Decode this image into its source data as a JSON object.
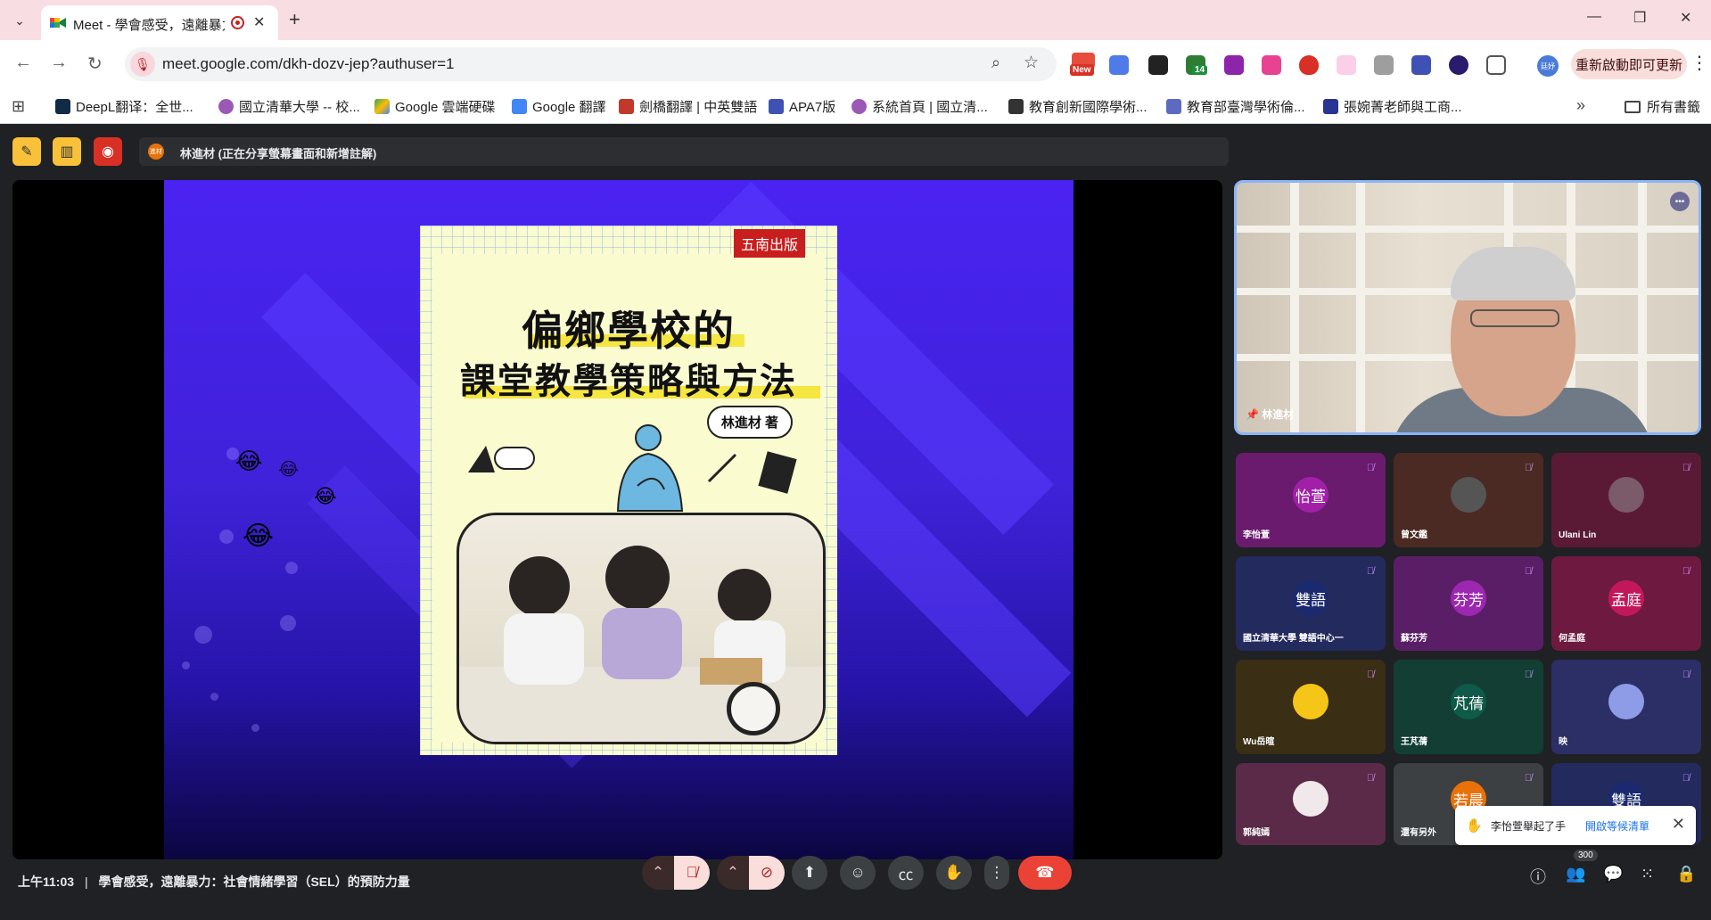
{
  "browser": {
    "tab_title": "Meet - 學會感受，遠離暴力",
    "url": "meet.google.com/dkh-dozv-jep?authuser=1",
    "new_badge": "New",
    "ext_badge": "14",
    "profile_initials": "廷妤",
    "restart_label": "重新啟動即可更新",
    "bookmarks": [
      {
        "label": "DeepL翻译：全世...",
        "color": "#0f2b46"
      },
      {
        "label": "國立清華大學 -- 校...",
        "color": "#9b59b6"
      },
      {
        "label": "Google 雲端硬碟",
        "color": "#34a853"
      },
      {
        "label": "Google 翻譯",
        "color": "#4285f4"
      },
      {
        "label": "劍橋翻譯 | 中英雙語",
        "color": "#c0392b"
      },
      {
        "label": "APA7版",
        "color": "#3f51b5"
      },
      {
        "label": "系統首頁 | 國立清...",
        "color": "#9b59b6"
      },
      {
        "label": "教育創新國際學術...",
        "color": "#333333"
      },
      {
        "label": "教育部臺灣學術倫...",
        "color": "#5c6bc0"
      },
      {
        "label": "張婉菁老師與工商...",
        "color": "#283593"
      }
    ],
    "all_bookmarks": "所有書籤"
  },
  "meet": {
    "presenter_avatar": "進材",
    "presenter_text": "林進材 (正在分享螢幕畫面和新增註解)",
    "slide": {
      "publisher": "五南出版",
      "title_line1": "偏鄉學校的",
      "title_line2": "課堂教學策略與方法",
      "author": "林進材 著"
    },
    "main_video": {
      "name": "林進材"
    },
    "tiles": [
      {
        "name": "李怡萱",
        "avatar": "怡萱",
        "bg": "#6a1b6e",
        "av": "#a020a8"
      },
      {
        "name": "曾文鑑",
        "avatar": "",
        "bg": "#4a2a22",
        "av": "#555555"
      },
      {
        "name": "Ulani Lin",
        "avatar": "",
        "bg": "#5a1a36",
        "av": "#7b5a6a"
      },
      {
        "name": "國立清華大學 雙語中心一",
        "avatar": "雙語",
        "bg": "#232a5e",
        "av": "#1b2a6e"
      },
      {
        "name": "蘇芬芳",
        "avatar": "芬芳",
        "bg": "#5a1e66",
        "av": "#9c27b0"
      },
      {
        "name": "何孟庭",
        "avatar": "孟庭",
        "bg": "#6e1a40",
        "av": "#c2185b"
      },
      {
        "name": "Wu岳暄",
        "avatar": "",
        "bg": "#3a2e14",
        "av": "#f5c518"
      },
      {
        "name": "王芃蒨",
        "avatar": "芃蒨",
        "bg": "#123e34",
        "av": "#0f5a48"
      },
      {
        "name": "映",
        "avatar": "",
        "bg": "#2c2e66",
        "av": "#8e9ce8"
      },
      {
        "name": "郭純嫣",
        "avatar": "",
        "bg": "#5a2a48",
        "av": "#f0e8ea"
      },
      {
        "name": "還有另外",
        "avatar": "若晨",
        "bg": "#3c4043",
        "av": "#e8710a"
      },
      {
        "name": "",
        "avatar": "雙語",
        "bg": "#232a5e",
        "av": "#1b2a6e"
      }
    ],
    "toast": {
      "message": "李怡萱舉起了手",
      "link": "開啟等候清單"
    },
    "bottom": {
      "time": "上午11:03",
      "separator": "|",
      "meeting_title": "學會感受，遠離暴力：社會情緒學習（SEL）的預防力量",
      "participants_count": "300"
    }
  }
}
